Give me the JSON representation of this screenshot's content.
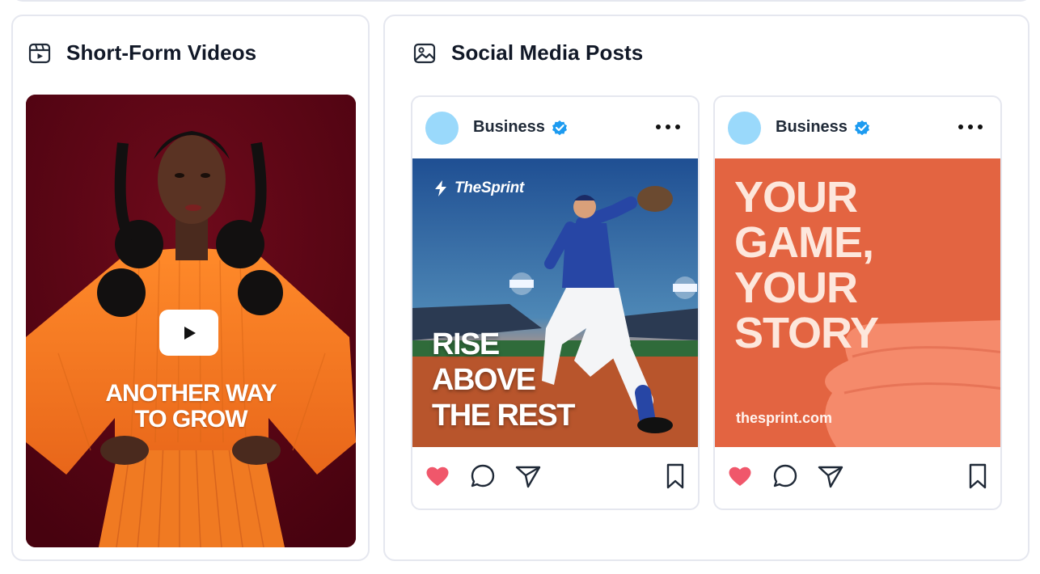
{
  "videos_card": {
    "title": "Short-Form Videos",
    "icon": "video-icon",
    "video": {
      "caption_line1": "ANOTHER WAY",
      "caption_line2": "TO GROW",
      "play_icon": "play-icon"
    }
  },
  "social_card": {
    "title": "Social Media Posts",
    "icon": "image-icon",
    "posts": [
      {
        "account": "Business",
        "verified_icon": "verified-badge-icon",
        "brand": "TheSprint",
        "headline": "RISE\nABOVE\nTHE REST",
        "url": ""
      },
      {
        "account": "Business",
        "verified_icon": "verified-badge-icon",
        "brand": "",
        "headline": "YOUR\nGAME,\nYOUR\nSTORY",
        "url": "thesprint.com"
      }
    ]
  },
  "colors": {
    "border": "#e5e7ef",
    "avatar": "#9ad9fb",
    "verified": "#1d9bf0",
    "like": "#f0576b",
    "post2_bg": "#e36441",
    "video_bg": "#560312"
  }
}
